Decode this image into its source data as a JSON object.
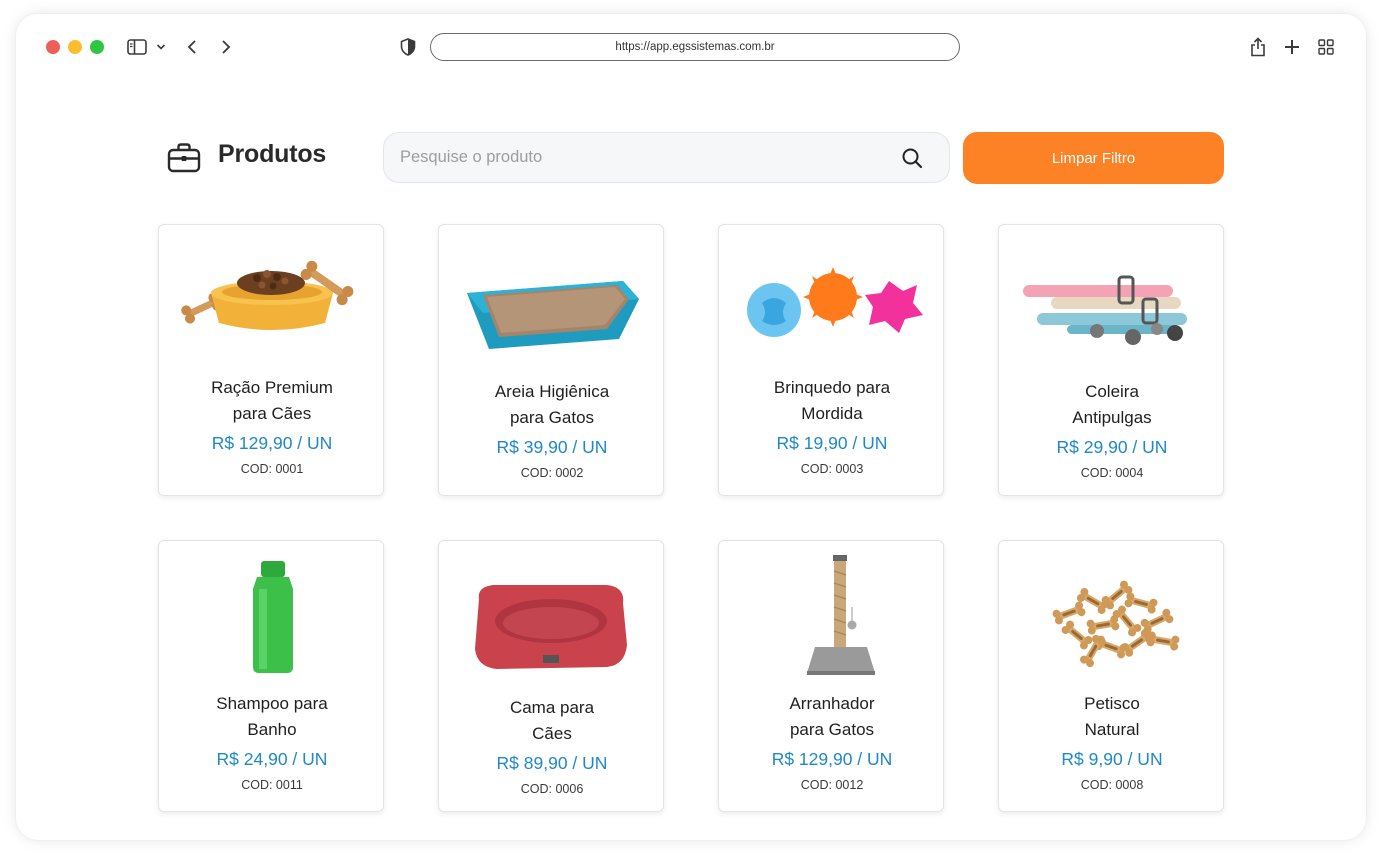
{
  "browser": {
    "url": "https://app.egssistemas.com.br"
  },
  "header": {
    "title": "Produtos",
    "search_placeholder": "Pesquise o produto",
    "clear_label": "Limpar Filtro"
  },
  "colors": {
    "accent": "#fd8225",
    "price": "#1e88c8"
  },
  "products": [
    {
      "name_line1": "Ração Premium",
      "name_line2": "para Cães",
      "price": "R$ 129,90 / UN",
      "code": "COD: 0001",
      "image": "dog-food-bowl"
    },
    {
      "name_line1": "Areia Higiênica",
      "name_line2": "para Gatos",
      "price": "R$ 39,90 / UN",
      "code": "COD: 0002",
      "image": "litter-box"
    },
    {
      "name_line1": "Brinquedo para",
      "name_line2": "Mordida",
      "price": "R$ 19,90 / UN",
      "code": "COD: 0003",
      "image": "chew-toys"
    },
    {
      "name_line1": "Coleira",
      "name_line2": "Antipulgas",
      "price": "R$ 29,90 / UN",
      "code": "COD: 0004",
      "image": "collars"
    },
    {
      "name_line1": "Shampoo para",
      "name_line2": "Banho",
      "price": "R$ 24,90 / UN",
      "code": "COD: 0011",
      "image": "shampoo-bottle"
    },
    {
      "name_line1": "Cama para",
      "name_line2": "Cães",
      "price": "R$ 89,90 / UN",
      "code": "COD: 0006",
      "image": "dog-bed"
    },
    {
      "name_line1": "Arranhador",
      "name_line2": "para Gatos",
      "price": "R$ 129,90 / UN",
      "code": "COD: 0012",
      "image": "scratching-post"
    },
    {
      "name_line1": "Petisco",
      "name_line2": "Natural",
      "price": "R$ 9,90 / UN",
      "code": "COD: 0008",
      "image": "bone-treats"
    }
  ]
}
